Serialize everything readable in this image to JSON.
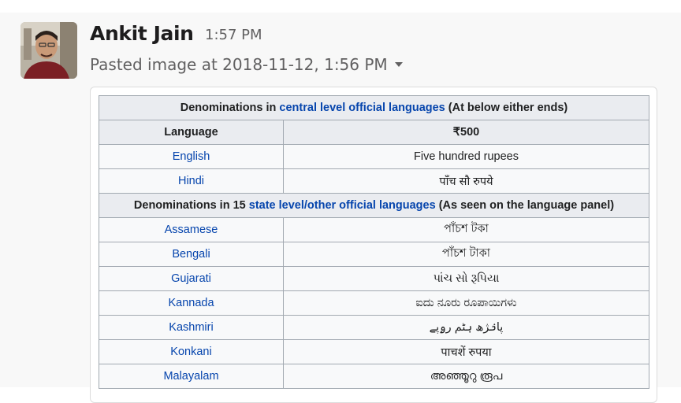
{
  "message": {
    "author": "Ankit Jain",
    "time": "1:57 PM",
    "file_title": "Pasted image at 2018-11-12, 1:56 PM",
    "file_menu_icon": "caret-down-icon",
    "avatar": "user-avatar"
  },
  "table": {
    "central_header": {
      "pre": "Denominations in ",
      "link": "central level official languages",
      "post": " (At below either ends)"
    },
    "col_headers": [
      "Language",
      "₹500"
    ],
    "central_rows": [
      {
        "language": "English",
        "text": "Five hundred rupees"
      },
      {
        "language": "Hindi",
        "text": "पाँच सौ रुपये"
      }
    ],
    "state_header": {
      "pre": "Denominations in 15 ",
      "link": "state level/other official languages",
      "post": " (As seen on the language panel)"
    },
    "state_rows": [
      {
        "language": "Assamese",
        "text": "পাঁচশ টকা"
      },
      {
        "language": "Bengali",
        "text": "পাঁচশ টাকা"
      },
      {
        "language": "Gujarati",
        "text": "પાંચ સો રૂપિયા"
      },
      {
        "language": "Kannada",
        "text": "ಐದು ನೂರು ರೂಪಾಯಿಗಳು"
      },
      {
        "language": "Kashmiri",
        "text": "پانٛژھ ہٹم رۄپے"
      },
      {
        "language": "Konkani",
        "text": "पाचशें रुपया"
      },
      {
        "language": "Malayalam",
        "text": "അഞ്ഞൂറു രൂപ"
      }
    ]
  }
}
